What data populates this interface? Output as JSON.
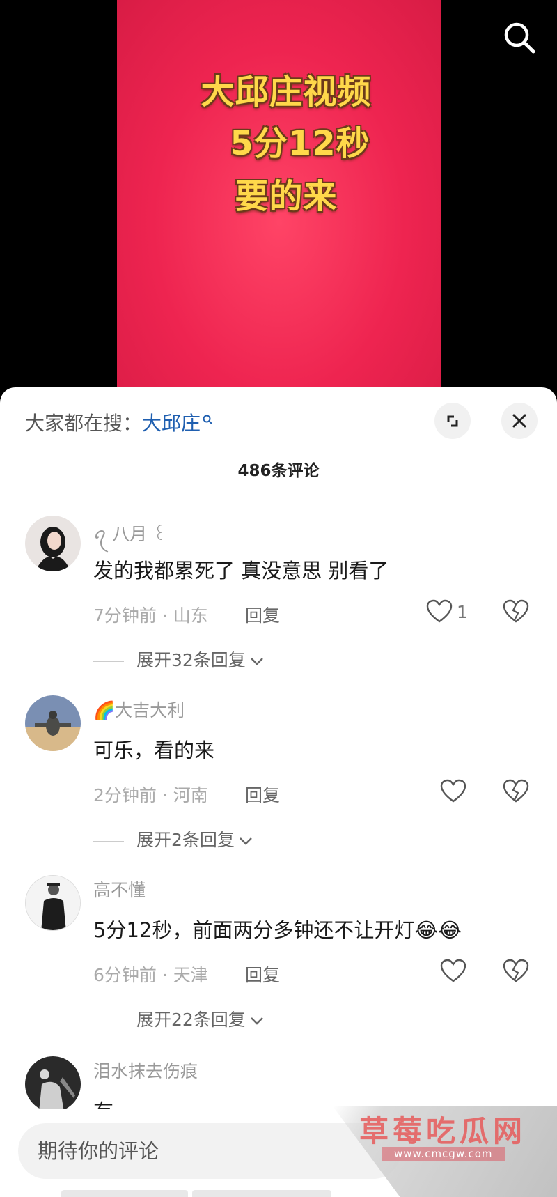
{
  "video": {
    "overlay_lines": [
      "大邱庄视频",
      "5分12秒",
      "要的来"
    ],
    "colors": {
      "frame": "#ee2450",
      "text": "#ffd84a"
    }
  },
  "header": {
    "hot_label": "大家都在搜：",
    "hot_keyword": "大邱庄",
    "count_label": "486条评论",
    "icons": [
      "search-icon",
      "expand-icon",
      "close-icon"
    ]
  },
  "comments": [
    {
      "user": "ꪖ 八月 ꒰",
      "text": "发的我都累死了 真没意思 别看了",
      "meta": "7分钟前 · 山东",
      "reply": "回复",
      "likes": "1",
      "expand": "展开32条回复"
    },
    {
      "user": "🌈大吉大利",
      "text": "可乐，看的来",
      "meta": "2分钟前 · 河南",
      "reply": "回复",
      "likes": "",
      "expand": "展开2条回复"
    },
    {
      "user": "高不懂",
      "text": "5分12秒，前面两分多钟还不让开灯😂😂",
      "meta": "6分钟前 · 天津",
      "reply": "回复",
      "likes": "",
      "expand": "展开22条回复"
    },
    {
      "user": "泪水抹去伤痕",
      "text": "有"
    }
  ],
  "input": {
    "placeholder": "期待你的评论"
  },
  "watermark": {
    "title": "草莓吃瓜网",
    "url": "www.cmcgw.com"
  }
}
